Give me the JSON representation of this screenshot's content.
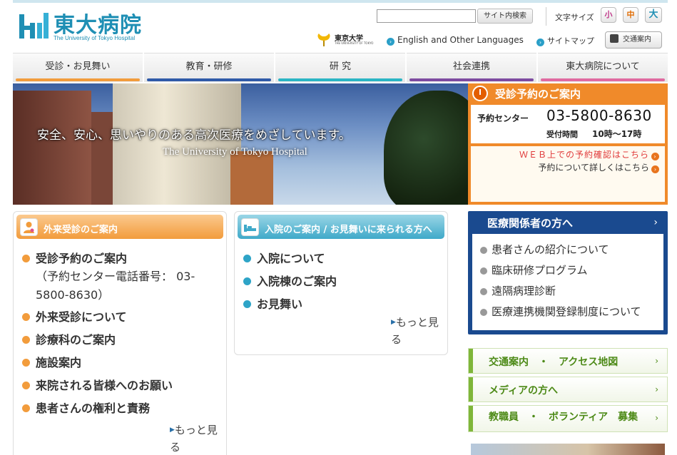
{
  "header": {
    "logo_jp": "東大病院",
    "logo_en": "The University of Tokyo Hospital",
    "search": {
      "placeholder": "",
      "button_label": "サイト内検索"
    },
    "font_size": {
      "label": "文字サイズ",
      "small": "小",
      "medium": "中",
      "large": "大"
    },
    "utokyo": {
      "jp": "東京大学",
      "en": "THE UNIVERSITY OF TOKYO"
    },
    "links": {
      "english": "English and Other Languages",
      "sitemap": "サイトマップ",
      "access": "交通案内"
    }
  },
  "nav": {
    "items": [
      {
        "label": "受診・お見舞い",
        "color": "#f29c3c"
      },
      {
        "label": "教育・研修",
        "color": "#2f5aa8"
      },
      {
        "label": "研 究",
        "color": "#2bb5c4"
      },
      {
        "label": "社会連携",
        "color": "#7d4aa0"
      },
      {
        "label": "東大病院について",
        "color": "#e06aa0"
      }
    ]
  },
  "hero": {
    "tagline_jp": "安全、安心、思いやりのある高次医療をめざしています。",
    "tagline_en": "The University of Tokyo Hospital"
  },
  "reservation": {
    "title": "受診予約のご案内",
    "center_label": "予約センター",
    "phone": "03-5800-8630",
    "hours_label": "受付時間",
    "hours": "10時〜17時",
    "web_link": "ＷＥＢ上での予約確認はこちら",
    "detail_link": "予約について詳しくはこちら"
  },
  "outpatient": {
    "title": "外来受診のご案内",
    "items": [
      {
        "label": "受診予約のご案内",
        "sub": "（予約センター電話番号： 03-5800-8630）"
      },
      {
        "label": "外来受診について"
      },
      {
        "label": "診療科のご案内"
      },
      {
        "label": "施設案内"
      },
      {
        "label": "来院される皆様へのお願い"
      },
      {
        "label": "患者さんの権利と責務"
      }
    ],
    "more": "もっと見る"
  },
  "inpatient": {
    "title": "入院のご案内 / お見舞いに来られる方へ",
    "items": [
      {
        "label": "入院について"
      },
      {
        "label": "入院棟のご案内"
      },
      {
        "label": "お見舞い"
      }
    ],
    "more": "もっと見る"
  },
  "professionals": {
    "title": "医療関係者の方へ",
    "items": [
      "患者さんの紹介について",
      "臨床研修プログラム",
      "遠隔病理診断",
      "医療連携機関登録制度について"
    ]
  },
  "side_links": {
    "access": "交通案内　・　アクセス地図",
    "media": "メディアの方へ",
    "staff": "教職員　・　ボランティア　募集"
  }
}
